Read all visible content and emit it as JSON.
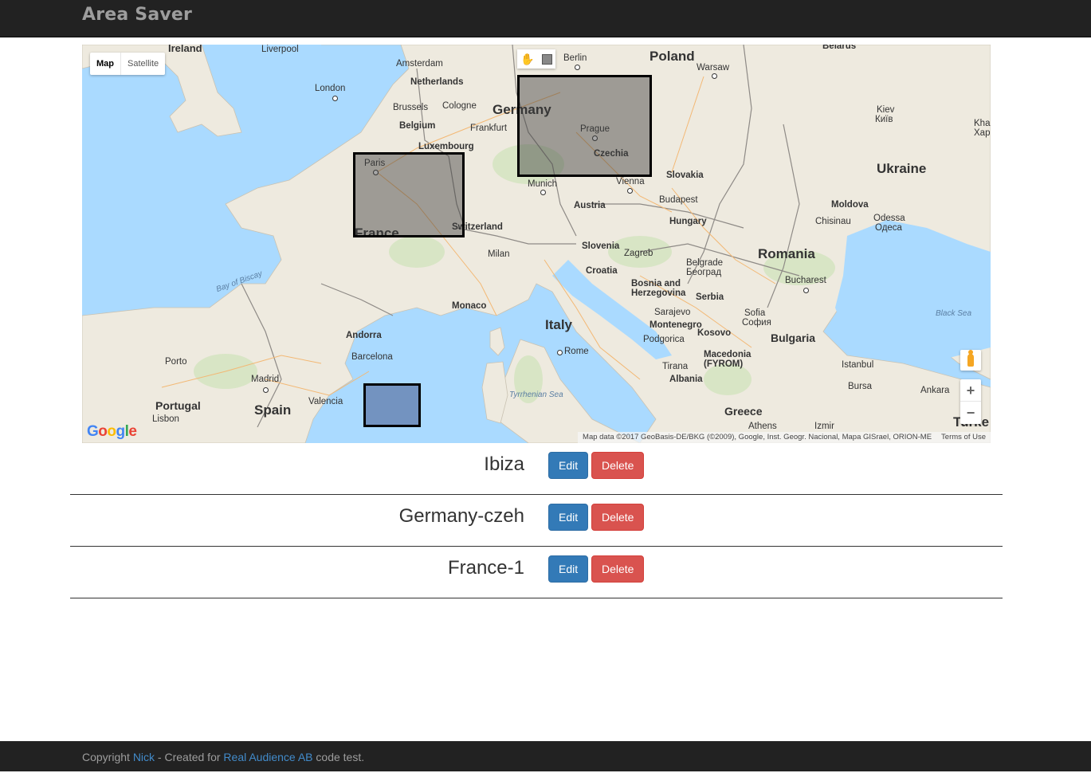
{
  "app": {
    "title": "Area Saver"
  },
  "map": {
    "type_controls": {
      "map": "Map",
      "satellite": "Satellite"
    },
    "countries": {
      "ireland": "Ireland",
      "netherlands": "Netherlands",
      "belgium": "Belgium",
      "luxembourg": "Luxembourg",
      "germany": "Germany",
      "poland": "Poland",
      "belarus": "Belarus",
      "france": "France",
      "switzerland": "Switzerland",
      "czechia": "Czechia",
      "slovakia": "Slovakia",
      "austria": "Austria",
      "hungary": "Hungary",
      "ukraine": "Ukraine",
      "moldova": "Moldova",
      "romania": "Romania",
      "slovenia": "Slovenia",
      "croatia": "Croatia",
      "bosnia": "Bosnia and Herzegovina",
      "serbia": "Serbia",
      "montenegro": "Montenegro",
      "kosovo": "Kosovo",
      "bulgaria": "Bulgaria",
      "macedonia": "Macedonia (FYROM)",
      "albania": "Albania",
      "italy": "Italy",
      "andorra": "Andorra",
      "monaco": "Monaco",
      "spain": "Spain",
      "portugal": "Portugal",
      "greece": "Greece",
      "turkey": "Turke"
    },
    "cities": {
      "liverpool": "Liverpool",
      "london": "London",
      "amsterdam": "Amsterdam",
      "brussels": "Brussels",
      "cologne": "Cologne",
      "frankfurt": "Frankfurt",
      "berlin": "Berlin",
      "warsaw": "Warsaw",
      "paris": "Paris",
      "prague": "Prague",
      "munich": "Munich",
      "vienna": "Vienna",
      "kiev": "Kiev",
      "kiev_local": "Київ",
      "kharkiv": "Kha",
      "kharkiv2": "Хар",
      "budapest": "Budapest",
      "chisinau": "Chisinau",
      "odessa": "Odessa",
      "odessa_local": "Одеса",
      "milan": "Milan",
      "zagreb": "Zagreb",
      "belgrade": "Belgrade",
      "belgrade_local": "Београд",
      "bucharest": "Bucharest",
      "sarajevo": "Sarajevo",
      "podgorica": "Podgorica",
      "sofia": "Sofia",
      "sofia_local": "София",
      "tirana": "Tirana",
      "rome": "Rome",
      "barcelona": "Barcelona",
      "valencia": "Valencia",
      "madrid": "Madrid",
      "porto": "Porto",
      "lisbon": "Lisbon",
      "athens": "Athens",
      "izmir": "Izmir",
      "istanbul": "Istanbul",
      "bursa": "Bursa",
      "ankara": "Ankara"
    },
    "seas": {
      "bay_of_biscay": "Bay of Biscay",
      "tyrrhenian": "Tyrrhenian Sea",
      "black_sea": "Black Sea"
    },
    "zoom_in": "+",
    "zoom_out": "−",
    "attribution": "Map data ©2017 GeoBasis-DE/BKG (©2009), Google, Inst. Geogr. Nacional, Mapa GISrael, ORION-ME",
    "terms": "Terms of Use",
    "logo": "Google"
  },
  "areas": [
    {
      "name": "Ibiza",
      "edit_label": "Edit",
      "delete_label": "Delete"
    },
    {
      "name": "Germany-czeh",
      "edit_label": "Edit",
      "delete_label": "Delete"
    },
    {
      "name": "France-1",
      "edit_label": "Edit",
      "delete_label": "Delete"
    }
  ],
  "footer": {
    "prefix": "Copyright ",
    "author": "Nick",
    "middle": " - Created for ",
    "company": "Real Audience AB",
    "suffix": " code test."
  },
  "colors": {
    "navbar": "#222222",
    "edit": "#337ab7",
    "delete": "#d9534f",
    "link": "#428bca",
    "water": "#aadaff",
    "land": "#eeeadf"
  }
}
